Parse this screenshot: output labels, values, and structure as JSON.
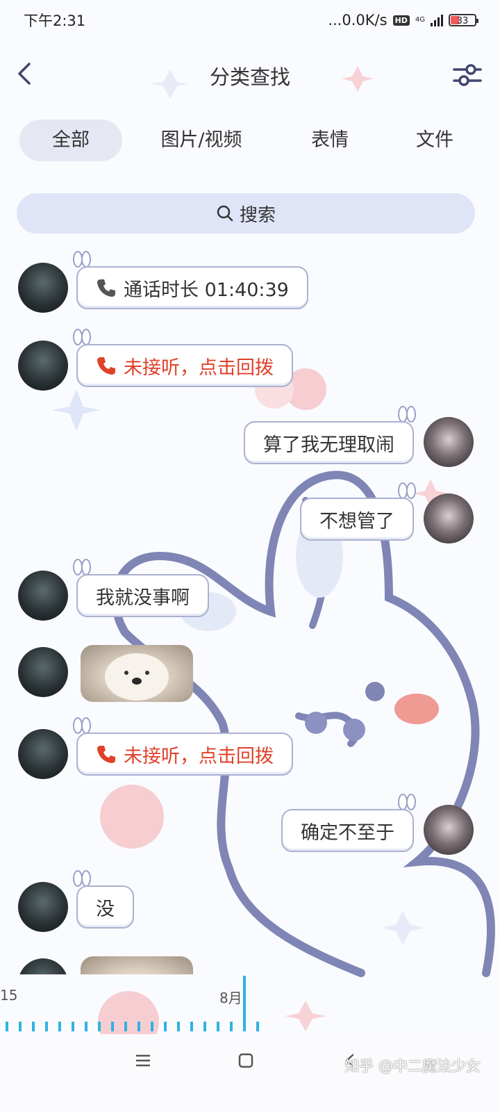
{
  "status_bar": {
    "time": "下午2:31",
    "net_speed": "...0.0K/s",
    "hd_badge": "HD",
    "network_type": "4G",
    "battery_level": "33"
  },
  "header": {
    "title": "分类查找",
    "back_icon": "back-arrow-icon",
    "filter_icon": "filter-sliders-icon"
  },
  "tabs": [
    {
      "label": "全部",
      "active": true
    },
    {
      "label": "图片/视频",
      "active": false
    },
    {
      "label": "表情",
      "active": false
    },
    {
      "label": "文件",
      "active": false
    }
  ],
  "search": {
    "label": "搜索",
    "icon": "search-icon"
  },
  "messages": [
    {
      "side": "left",
      "type": "call",
      "text": "通话时长 01:40:39",
      "icon": "phone-icon"
    },
    {
      "side": "left",
      "type": "missed_call",
      "text": "未接听，点击回拨",
      "icon": "missed-call-icon"
    },
    {
      "side": "right",
      "type": "text",
      "text": "算了我无理取闹"
    },
    {
      "side": "right",
      "type": "text",
      "text": "不想管了"
    },
    {
      "side": "left",
      "type": "text",
      "text": "我就没事啊"
    },
    {
      "side": "left",
      "type": "sticker",
      "text": ""
    },
    {
      "side": "left",
      "type": "missed_call",
      "text": "未接听，点击回拨",
      "icon": "missed-call-icon"
    },
    {
      "side": "right",
      "type": "text",
      "text": "确定不至于"
    },
    {
      "side": "left",
      "type": "text",
      "text": "没"
    },
    {
      "side": "left",
      "type": "sticker",
      "text": ""
    }
  ],
  "timeline": {
    "left_label": "15",
    "month_label": "8月"
  },
  "nav_bar": {
    "menu_icon": "menu-icon",
    "home_icon": "home-square-icon",
    "back_icon": "back-triangle-icon",
    "watermark": "知乎 @中二魔法少女"
  },
  "colors": {
    "missed_call": "#e0412a",
    "bubble_border": "#aab1d0",
    "search_bg": "#dfe4f6",
    "timeline_accent": "#2fb3e0"
  }
}
